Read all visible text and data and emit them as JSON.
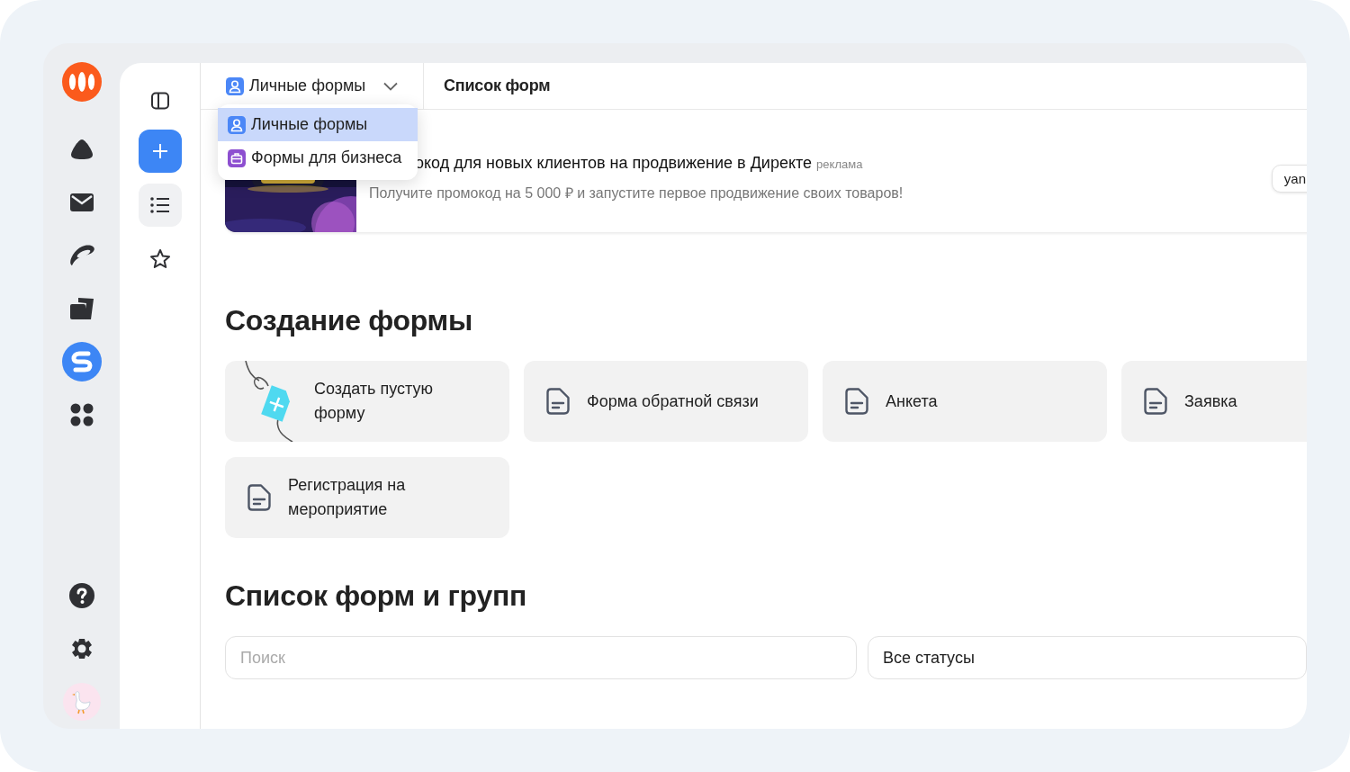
{
  "tools": [
    {
      "kind": "list",
      "selected": true
    },
    {
      "kind": "favorites",
      "selected": false
    }
  ],
  "header": {
    "workspace": "Личные формы",
    "title": "Список форм"
  },
  "workspace_menu": {
    "items": [
      {
        "kind": "personal",
        "label": "Личные формы",
        "selected": true
      },
      {
        "kind": "business",
        "label": "Формы для бизнеса",
        "selected": false
      }
    ]
  },
  "ad": {
    "title": "окод для новых клиентов на продвижение в Директе",
    "badge": "реклама",
    "text": "Получите промокод на 5 000 ₽ и запустите первое продвижение своих товаров!",
    "button": "yan"
  },
  "create": {
    "heading": "Создание формы",
    "templates": [
      {
        "kind": "blank",
        "label": "Создать пустую форму"
      },
      {
        "kind": "template",
        "label": "Форма обратной связи"
      },
      {
        "kind": "template",
        "label": "Анкета"
      },
      {
        "kind": "template",
        "label": "Заявка"
      },
      {
        "kind": "template",
        "label": "Регистрация на мероприятие"
      }
    ]
  },
  "forms_list": {
    "heading": "Список форм и групп",
    "search": {
      "placeholder": "Поиск"
    },
    "status": {
      "value": "Все статусы"
    }
  }
}
